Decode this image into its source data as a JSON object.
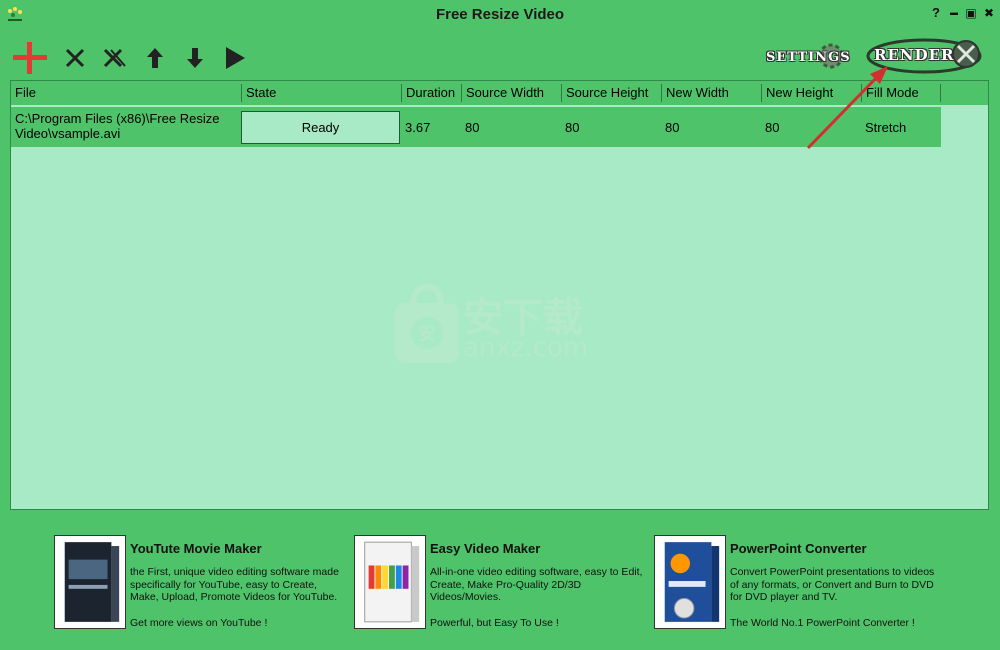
{
  "window": {
    "title": "Free Resize Video",
    "help": "?",
    "minimize": "▬",
    "maximize": "▣",
    "close": "✖"
  },
  "toolbar": {
    "icons": [
      "add-icon",
      "remove-icon",
      "remove-all-icon",
      "move-up-icon",
      "move-down-icon",
      "play-icon"
    ],
    "settings_label": "SETTINGS",
    "render_label": "RENDER",
    "accent_add": "#e53935",
    "accent_arrow": "#d32f2f"
  },
  "table": {
    "columns": [
      "File",
      "State",
      "Duration",
      "Source Width",
      "Source Height",
      "New Width",
      "New Height",
      "Fill Mode"
    ],
    "rows": [
      {
        "file_line1": "C:\\Program Files (x86)\\Free Resize",
        "file_line2": "Video\\vsample.avi",
        "state": "Ready",
        "duration": "3.67",
        "source_width": "80",
        "source_height": "80",
        "new_width": "80",
        "new_height": "80",
        "fill_mode": "Stretch"
      }
    ]
  },
  "watermark": {
    "cn": "安下载",
    "domain": "anxz.com"
  },
  "ads": [
    {
      "title": "YouTute Movie Maker",
      "desc": "the First, unique video editing software made specifically for YouTube, easy to Create, Make, Upload, Promote Videos for YouTube.",
      "foot": "Get more views on YouTube !"
    },
    {
      "title": "Easy Video Maker",
      "desc": "All-in-one video editing software, easy to Edit, Create, Make Pro-Quality 2D/3D Videos/Movies.",
      "foot": "Powerful, but Easy To Use !"
    },
    {
      "title": "PowerPoint Converter",
      "desc": "Convert PowerPoint presentations to videos of any formats, or Convert and Burn to DVD for DVD player and TV.",
      "foot": "The World No.1 PowerPoint Converter !"
    }
  ],
  "colors": {
    "background": "#4fc36a",
    "panel": "#a8eac5"
  }
}
